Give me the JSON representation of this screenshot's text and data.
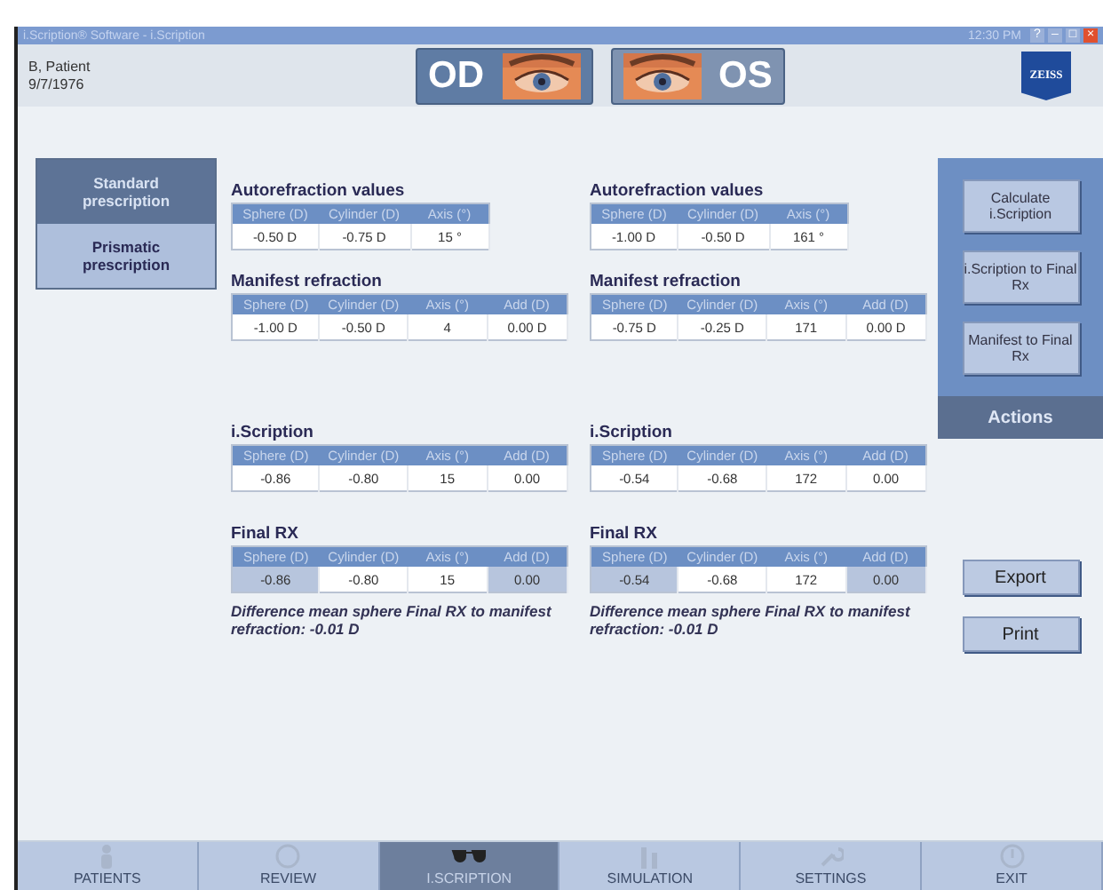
{
  "window": {
    "title": "i.Scription® Software - i.Scription",
    "time": "12:30 PM",
    "controls": [
      "?",
      "–",
      "□",
      "×"
    ]
  },
  "patient": {
    "name": "B, Patient",
    "birthdate": "9/7/1976"
  },
  "eyes": [
    {
      "label": "OD",
      "selected": true
    },
    {
      "label": "OS",
      "selected": false
    }
  ],
  "logo": "ZEISS",
  "prescription_tabs": [
    {
      "label": "Standard prescription",
      "selected": true
    },
    {
      "label": "Prismatic prescription",
      "selected": false
    }
  ],
  "panels": [
    {
      "sections": [
        {
          "title": "Autorefraction values",
          "columns": [
            "Sphere (D)",
            "Cylinder (D)",
            "Axis (°)"
          ],
          "cells": [
            {
              "text": "-0.50 D",
              "highlighted": false
            },
            {
              "text": "-0.75 D",
              "highlighted": false
            },
            {
              "text": "15 °",
              "highlighted": false
            }
          ]
        },
        {
          "title": "Manifest refraction",
          "columns": [
            "Sphere (D)",
            "Cylinder (D)",
            "Axis (°)",
            "Add (D)"
          ],
          "cells": [
            {
              "text": "-1.00 D",
              "highlighted": false
            },
            {
              "text": "-0.50 D",
              "highlighted": false
            },
            {
              "text": "4",
              "highlighted": false
            },
            {
              "text": "0.00 D",
              "highlighted": false
            }
          ]
        },
        {
          "title": "i.Scription",
          "columns": [
            "Sphere (D)",
            "Cylinder (D)",
            "Axis (°)",
            "Add (D)"
          ],
          "cells": [
            {
              "text": "-0.86",
              "highlighted": false
            },
            {
              "text": "-0.80",
              "highlighted": false
            },
            {
              "text": "15",
              "highlighted": false
            },
            {
              "text": "0.00",
              "highlighted": false
            }
          ]
        },
        {
          "title": "Final RX",
          "columns": [
            "Sphere (D)",
            "Cylinder (D)",
            "Axis (°)",
            "Add (D)"
          ],
          "cells": [
            {
              "text": "-0.86",
              "highlighted": true
            },
            {
              "text": "-0.80",
              "highlighted": false
            },
            {
              "text": "15",
              "highlighted": false
            },
            {
              "text": "0.00",
              "highlighted": true
            }
          ]
        }
      ],
      "note": "Difference mean sphere Final RX to manifest refraction: -0.01 D"
    },
    {
      "sections": [
        {
          "title": "Autorefraction values",
          "columns": [
            "Sphere (D)",
            "Cylinder (D)",
            "Axis (°)"
          ],
          "cells": [
            {
              "text": "-1.00 D",
              "highlighted": false
            },
            {
              "text": "-0.50 D",
              "highlighted": false
            },
            {
              "text": "161 °",
              "highlighted": false
            }
          ]
        },
        {
          "title": "Manifest refraction",
          "columns": [
            "Sphere (D)",
            "Cylinder (D)",
            "Axis (°)",
            "Add (D)"
          ],
          "cells": [
            {
              "text": "-0.75 D",
              "highlighted": false
            },
            {
              "text": "-0.25 D",
              "highlighted": false
            },
            {
              "text": "171",
              "highlighted": false
            },
            {
              "text": "0.00 D",
              "highlighted": false
            }
          ]
        },
        {
          "title": "i.Scription",
          "columns": [
            "Sphere (D)",
            "Cylinder (D)",
            "Axis (°)",
            "Add (D)"
          ],
          "cells": [
            {
              "text": "-0.54",
              "highlighted": false
            },
            {
              "text": "-0.68",
              "highlighted": false
            },
            {
              "text": "172",
              "highlighted": false
            },
            {
              "text": "0.00",
              "highlighted": false
            }
          ]
        },
        {
          "title": "Final RX",
          "columns": [
            "Sphere (D)",
            "Cylinder (D)",
            "Axis (°)",
            "Add (D)"
          ],
          "cells": [
            {
              "text": "-0.54",
              "highlighted": true
            },
            {
              "text": "-0.68",
              "highlighted": false
            },
            {
              "text": "172",
              "highlighted": false
            },
            {
              "text": "0.00",
              "highlighted": true
            }
          ]
        }
      ],
      "note": "Difference mean sphere Final RX to manifest refraction: -0.01 D"
    }
  ],
  "actions": {
    "buttons": [
      "Calculate i.Scription",
      "i.Scription to Final Rx",
      "Manifest to Final Rx"
    ],
    "title": "Actions"
  },
  "buttons": [
    "Export",
    "Print"
  ],
  "nav": [
    {
      "label": "PATIENTS",
      "selected": false
    },
    {
      "label": "REVIEW",
      "selected": false
    },
    {
      "label": "I.SCRIPTION",
      "selected": true
    },
    {
      "label": "SIMULATION",
      "selected": false
    },
    {
      "label": "SETTINGS",
      "selected": false
    },
    {
      "label": "EXIT",
      "selected": false
    }
  ]
}
